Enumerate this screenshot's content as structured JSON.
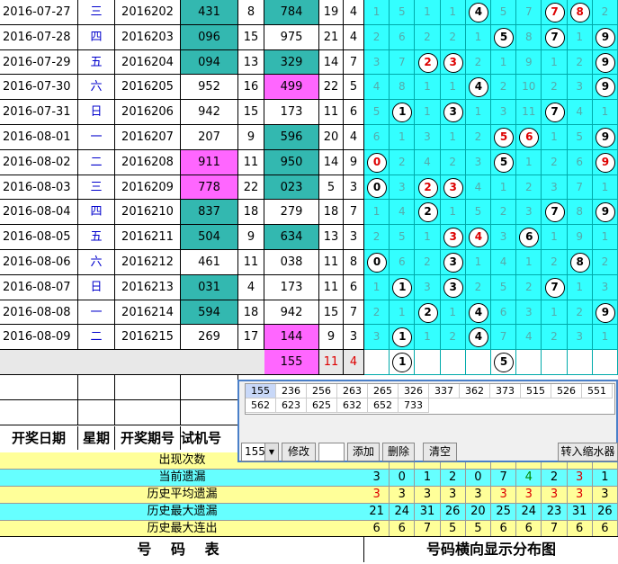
{
  "draw_rows": [
    {
      "date": "2016-07-27",
      "weekday": "三",
      "period": "2016202",
      "test_no": "431",
      "test_sum": "8",
      "draw_no": "784",
      "draw_sum": "19",
      "span": "4",
      "dist": [
        "1",
        "5",
        "1",
        "1",
        "4",
        "5",
        "7",
        "7",
        "8",
        "2"
      ],
      "circles": {
        "4": "4",
        "7": "7",
        "8": "8"
      },
      "red": [
        "7",
        "8"
      ]
    },
    {
      "date": "2016-07-28",
      "weekday": "四",
      "period": "2016203",
      "test_no": "096",
      "test_sum": "15",
      "draw_no": "975",
      "draw_sum": "21",
      "span": "4",
      "dist": [
        "2",
        "6",
        "2",
        "2",
        "1",
        "5",
        "8",
        "7",
        "1",
        "9"
      ],
      "circles": {
        "5": "5",
        "7": "7",
        "9": "9"
      },
      "red": []
    },
    {
      "date": "2016-07-29",
      "weekday": "五",
      "period": "2016204",
      "test_no": "094",
      "test_sum": "13",
      "draw_no": "329",
      "draw_sum": "14",
      "span": "7",
      "dist": [
        "3",
        "7",
        "2",
        "3",
        "2",
        "1",
        "9",
        "1",
        "2",
        "9"
      ],
      "circles": {
        "2": "2",
        "3": "3",
        "9": "9"
      },
      "red": [
        "2",
        "3"
      ]
    },
    {
      "date": "2016-07-30",
      "weekday": "六",
      "period": "2016205",
      "test_no": "952",
      "test_sum": "16",
      "draw_no": "499",
      "draw_sum": "22",
      "span": "5",
      "dist": [
        "4",
        "8",
        "1",
        "1",
        "4",
        "2",
        "10",
        "2",
        "3",
        "9"
      ],
      "circles": {
        "4": "4",
        "9": "9"
      },
      "red": []
    },
    {
      "date": "2016-07-31",
      "weekday": "日",
      "period": "2016206",
      "test_no": "942",
      "test_sum": "15",
      "draw_no": "173",
      "draw_sum": "11",
      "span": "6",
      "dist": [
        "5",
        "1",
        "1",
        "3",
        "1",
        "3",
        "11",
        "7",
        "4",
        "1"
      ],
      "circles": {
        "1": "1",
        "3": "3",
        "7": "7"
      },
      "red": []
    },
    {
      "date": "2016-08-01",
      "weekday": "一",
      "period": "2016207",
      "test_no": "207",
      "test_sum": "9",
      "draw_no": "596",
      "draw_sum": "20",
      "span": "4",
      "dist": [
        "6",
        "1",
        "3",
        "1",
        "2",
        "5",
        "6",
        "1",
        "5",
        "9"
      ],
      "circles": {
        "5": "5",
        "6": "6",
        "9": "9"
      },
      "red": [
        "5",
        "6"
      ]
    },
    {
      "date": "2016-08-02",
      "weekday": "二",
      "period": "2016208",
      "test_no": "911",
      "test_sum": "11",
      "draw_no": "950",
      "draw_sum": "14",
      "span": "9",
      "dist": [
        "0",
        "2",
        "4",
        "2",
        "3",
        "5",
        "1",
        "2",
        "6",
        "9"
      ],
      "circles": {
        "0": "0",
        "5": "5",
        "9": "9"
      },
      "red": [
        "0",
        "9"
      ]
    },
    {
      "date": "2016-08-03",
      "weekday": "三",
      "period": "2016209",
      "test_no": "778",
      "test_sum": "22",
      "draw_no": "023",
      "draw_sum": "5",
      "span": "3",
      "dist": [
        "0",
        "3",
        "2",
        "3",
        "4",
        "1",
        "2",
        "3",
        "7",
        "1"
      ],
      "circles": {
        "0": "0",
        "2": "2",
        "3": "3"
      },
      "red": [
        "2",
        "3"
      ]
    },
    {
      "date": "2016-08-04",
      "weekday": "四",
      "period": "2016210",
      "test_no": "837",
      "test_sum": "18",
      "draw_no": "279",
      "draw_sum": "18",
      "span": "7",
      "dist": [
        "1",
        "4",
        "2",
        "1",
        "5",
        "2",
        "3",
        "7",
        "8",
        "9"
      ],
      "circles": {
        "2": "2",
        "7": "7",
        "9": "9"
      },
      "red": []
    },
    {
      "date": "2016-08-05",
      "weekday": "五",
      "period": "2016211",
      "test_no": "504",
      "test_sum": "9",
      "draw_no": "634",
      "draw_sum": "13",
      "span": "3",
      "dist": [
        "2",
        "5",
        "1",
        "3",
        "4",
        "3",
        "6",
        "1",
        "9",
        "1"
      ],
      "circles": {
        "3": "3",
        "4": "4",
        "6": "6"
      },
      "red": [
        "3",
        "4"
      ]
    },
    {
      "date": "2016-08-06",
      "weekday": "六",
      "period": "2016212",
      "test_no": "461",
      "test_sum": "11",
      "draw_no": "038",
      "draw_sum": "11",
      "span": "8",
      "dist": [
        "0",
        "6",
        "2",
        "3",
        "1",
        "4",
        "1",
        "2",
        "8",
        "2"
      ],
      "circles": {
        "0": "0",
        "3": "3",
        "8": "8"
      },
      "red": []
    },
    {
      "date": "2016-08-07",
      "weekday": "日",
      "period": "2016213",
      "test_no": "031",
      "test_sum": "4",
      "draw_no": "173",
      "draw_sum": "11",
      "span": "6",
      "dist": [
        "1",
        "1",
        "3",
        "3",
        "2",
        "5",
        "2",
        "7",
        "1",
        "3"
      ],
      "circles": {
        "1": "1",
        "3": "3",
        "7": "7"
      },
      "red": []
    },
    {
      "date": "2016-08-08",
      "weekday": "一",
      "period": "2016214",
      "test_no": "594",
      "test_sum": "18",
      "draw_no": "942",
      "draw_sum": "15",
      "span": "7",
      "dist": [
        "2",
        "1",
        "2",
        "1",
        "4",
        "6",
        "3",
        "1",
        "2",
        "9"
      ],
      "circles": {
        "2": "2",
        "4": "4",
        "9": "9"
      },
      "red": []
    },
    {
      "date": "2016-08-09",
      "weekday": "二",
      "period": "2016215",
      "test_no": "269",
      "test_sum": "17",
      "draw_no": "144",
      "draw_sum": "9",
      "span": "3",
      "dist": [
        "3",
        "1",
        "1",
        "2",
        "4",
        "7",
        "4",
        "2",
        "3",
        "1"
      ],
      "circles": {
        "1": "1",
        "4": "4"
      },
      "red": []
    }
  ],
  "extra_row": {
    "draw_no": "155",
    "draw_sum": "11",
    "span": "4",
    "circles": {
      "1": "1",
      "5": "5"
    }
  },
  "headers": {
    "date": "开奖日期",
    "weekday": "星期",
    "period": "开奖期号",
    "test_no": "试机号"
  },
  "stats": [
    {
      "label": "出现次数",
      "values": []
    },
    {
      "label": "当前遗漏",
      "values": [
        "3",
        "0",
        "1",
        "2",
        "0",
        "7",
        "4",
        "2",
        "3",
        "1"
      ],
      "red_idx": [
        8
      ]
    },
    {
      "label": "历史平均遗漏",
      "values": [
        "3",
        "3",
        "3",
        "3",
        "3",
        "3",
        "3",
        "3",
        "3",
        "3"
      ],
      "red_idx": [
        0,
        5,
        6,
        7,
        8
      ]
    },
    {
      "label": "历史最大遗漏",
      "values": [
        "21",
        "24",
        "31",
        "26",
        "20",
        "25",
        "24",
        "23",
        "31",
        "26"
      ],
      "red_idx": []
    },
    {
      "label": "历史最大连出",
      "values": [
        "6",
        "6",
        "7",
        "5",
        "5",
        "6",
        "6",
        "7",
        "6",
        "6"
      ],
      "red_idx": []
    }
  ],
  "footer": {
    "left": "号 码 表",
    "right": "号码横向显示分布图"
  },
  "popup": {
    "numbers": [
      [
        "155",
        "236",
        "256",
        "263",
        "265",
        "326",
        "337",
        "362",
        "373",
        "515",
        "526",
        "551"
      ],
      [
        "562",
        "623",
        "625",
        "632",
        "652",
        "733"
      ]
    ],
    "select_value": "155",
    "buttons": {
      "modify": "修改",
      "add": "添加",
      "delete": "删除",
      "clear": "清空",
      "transfer": "转入缩水器"
    }
  },
  "colors": {
    "teal": "#33b8b0",
    "pink": "#ff66ff",
    "cyan": "#33ffff",
    "red": "#dd0000",
    "weekday_blue": "#0000cc"
  }
}
